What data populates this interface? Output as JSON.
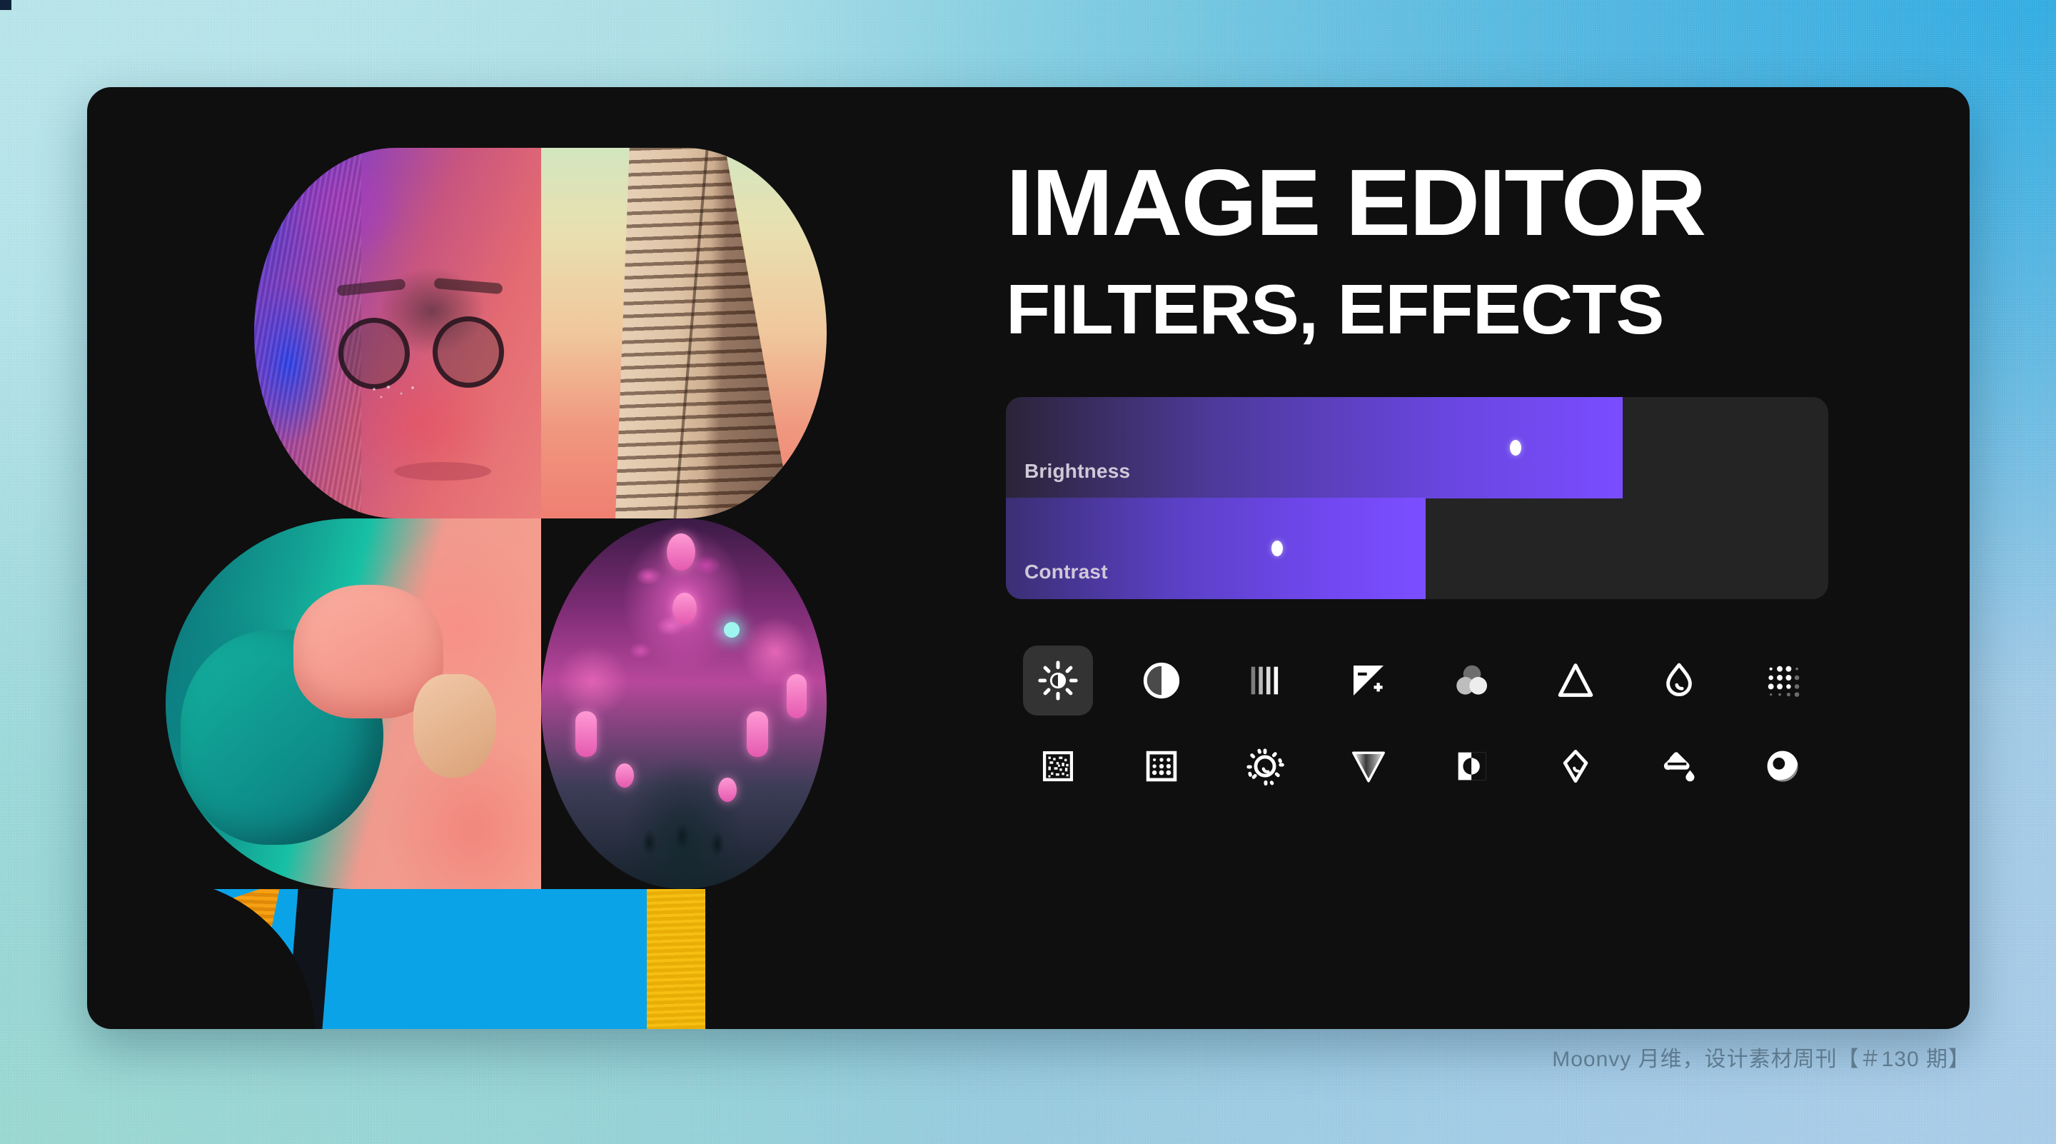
{
  "background": {
    "gradient_colors": [
      "#b4e3ea",
      "#33ade2",
      "#a9cde9",
      "#9cd8d2"
    ]
  },
  "panel": {
    "background_color": "#0f0f0f"
  },
  "heading": {
    "line1": "IMAGE EDITOR",
    "line2": "FILTERS, EFFECTS",
    "color": "#ffffff"
  },
  "collage": {
    "tiles": [
      {
        "name": "portrait-tile",
        "description": "Portrait with glasses, pink and blue tint"
      },
      {
        "name": "building-tile",
        "description": "High-rise building against sunset gradient sky"
      },
      {
        "name": "clothing-tile",
        "description": "Teal and coral sleeves with hands"
      },
      {
        "name": "alley-tile",
        "description": "Japanese alley with pink lanterns"
      },
      {
        "name": "architecture-tile",
        "description": "Blue, orange and yellow architectural detail"
      }
    ]
  },
  "sliders": {
    "panel_background": "#242424",
    "fill_start_color": "#2b2438",
    "fill_end_color": "#7a4dff",
    "items": [
      {
        "label": "Brightness",
        "fill_percent": 75,
        "handle_percent": 62
      },
      {
        "label": "Contrast",
        "fill_percent": 51,
        "handle_percent": 33
      }
    ]
  },
  "filters": {
    "selected_index": 0,
    "selected_background": "#333333",
    "rows": [
      [
        {
          "name": "brightness-icon",
          "label": "Brightness"
        },
        {
          "name": "contrast-icon",
          "label": "Contrast"
        },
        {
          "name": "levels-icon",
          "label": "Levels"
        },
        {
          "name": "exposure-icon",
          "label": "Exposure"
        },
        {
          "name": "color-mix-icon",
          "label": "Color Mix"
        },
        {
          "name": "sharpen-triangle-icon",
          "label": "Sharpen"
        },
        {
          "name": "water-drop-icon",
          "label": "Saturation"
        },
        {
          "name": "dot-matrix-icon",
          "label": "Dither"
        }
      ],
      [
        {
          "name": "noise-square-icon",
          "label": "Noise"
        },
        {
          "name": "halftone-square-icon",
          "label": "Halftone"
        },
        {
          "name": "glow-circle-icon",
          "label": "Glow"
        },
        {
          "name": "gradient-triangle-icon",
          "label": "Gradient"
        },
        {
          "name": "invert-square-icon",
          "label": "Invert"
        },
        {
          "name": "hex-drop-icon",
          "label": "Tint"
        },
        {
          "name": "paint-bucket-icon",
          "label": "Fill"
        },
        {
          "name": "vignette-moon-icon",
          "label": "Vignette"
        }
      ]
    ]
  },
  "footer": {
    "text": "Moonvy 月维，设计素材周刊【＃130 期】",
    "color": "#5e7a8e"
  }
}
